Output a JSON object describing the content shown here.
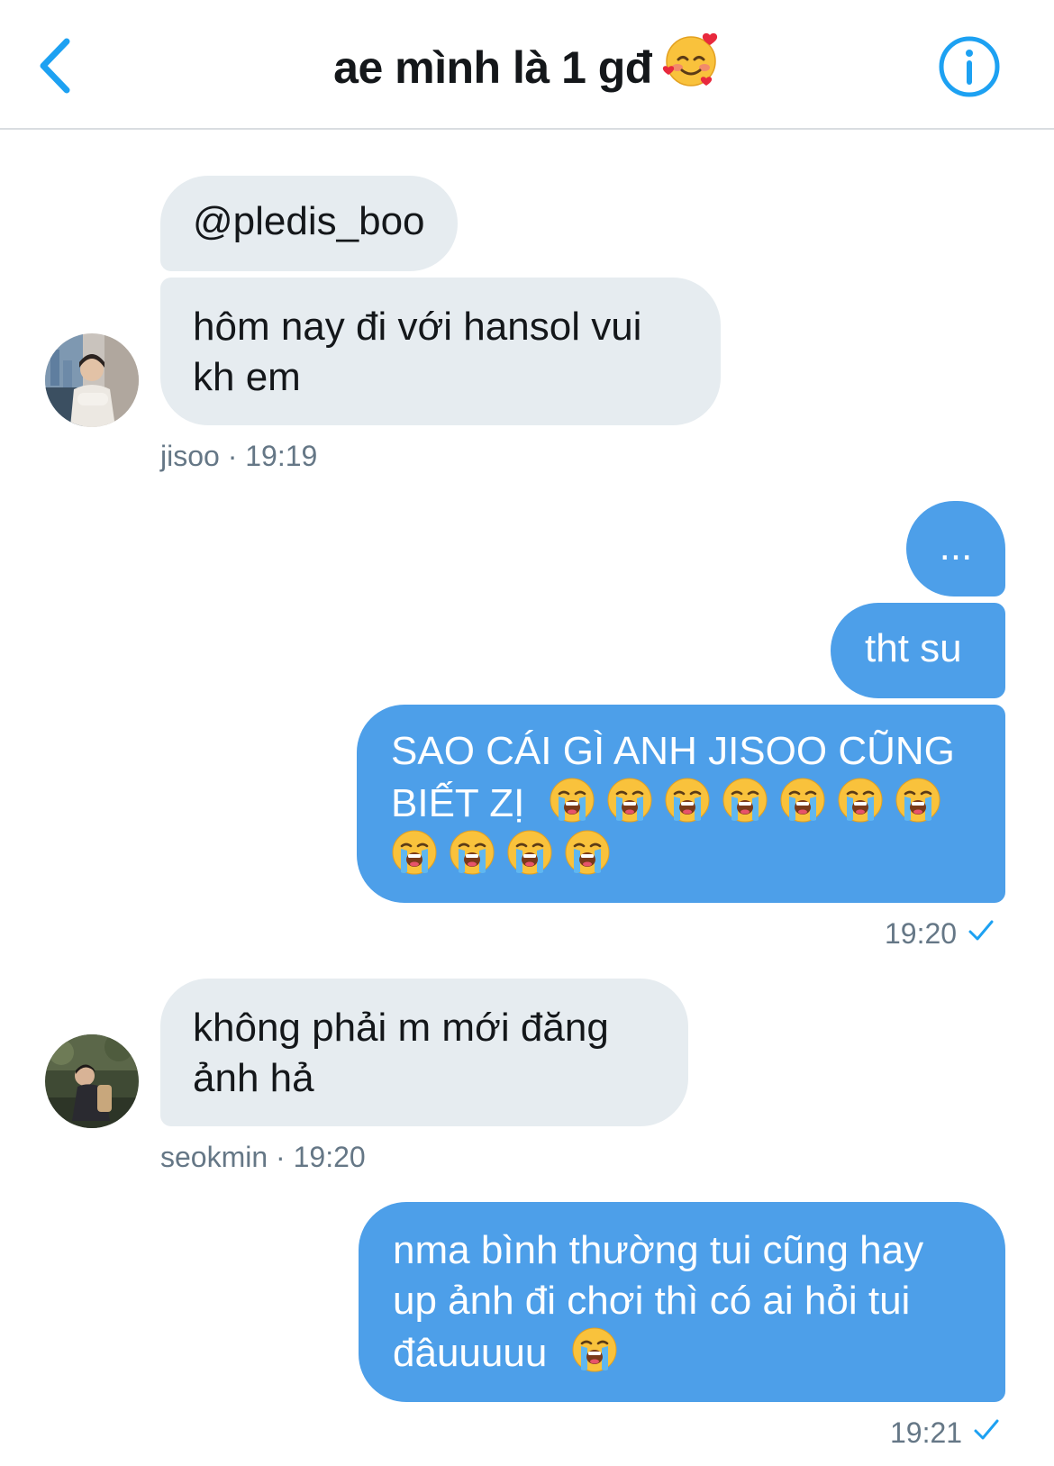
{
  "header": {
    "title": "ae mình là 1 gđ",
    "title_emoji": "smiling-face-with-hearts-icon",
    "back_icon": "chevron-left-icon",
    "info_icon": "info-circle-icon"
  },
  "colors": {
    "accent": "#1da1f2",
    "outgoing_bubble": "#4d9fe9",
    "incoming_bubble": "#e6ecf0",
    "meta_text": "#657786"
  },
  "messages": [
    {
      "id": "m1",
      "direction": "incoming",
      "text": "@pledis_boo"
    },
    {
      "id": "m2",
      "direction": "incoming",
      "text": "hôm nay đi với hansol vui kh em"
    },
    {
      "id": "meta1",
      "sender": "jisoo",
      "time": "19:19",
      "label": "jisoo · 19:19"
    },
    {
      "id": "m3",
      "direction": "outgoing",
      "text": "..."
    },
    {
      "id": "m4",
      "direction": "outgoing",
      "text": "tht su"
    },
    {
      "id": "m5",
      "direction": "outgoing",
      "text_line1": "SAO CÁI GÌ ANH JISOO CŨNG",
      "text_line2": "BIẾT ZỊ",
      "emoji": "loudly-crying-face-icon",
      "emoji_count": 11
    },
    {
      "id": "meta2",
      "time": "19:20",
      "status_icon": "check-icon"
    },
    {
      "id": "m6",
      "direction": "incoming",
      "text": "không phải m mới đăng ảnh hả"
    },
    {
      "id": "meta3",
      "sender": "seokmin",
      "time": "19:20",
      "label": "seokmin · 19:20"
    },
    {
      "id": "m7",
      "direction": "outgoing",
      "text_line1": "nma bình thường tui cũng hay",
      "text_line2": "up ảnh đi chơi thì có ai hỏi tui",
      "text_line3": "đâuuuuu",
      "emoji": "loudly-crying-face-icon"
    },
    {
      "id": "meta4",
      "time": "19:21",
      "status_icon": "check-icon"
    }
  ]
}
